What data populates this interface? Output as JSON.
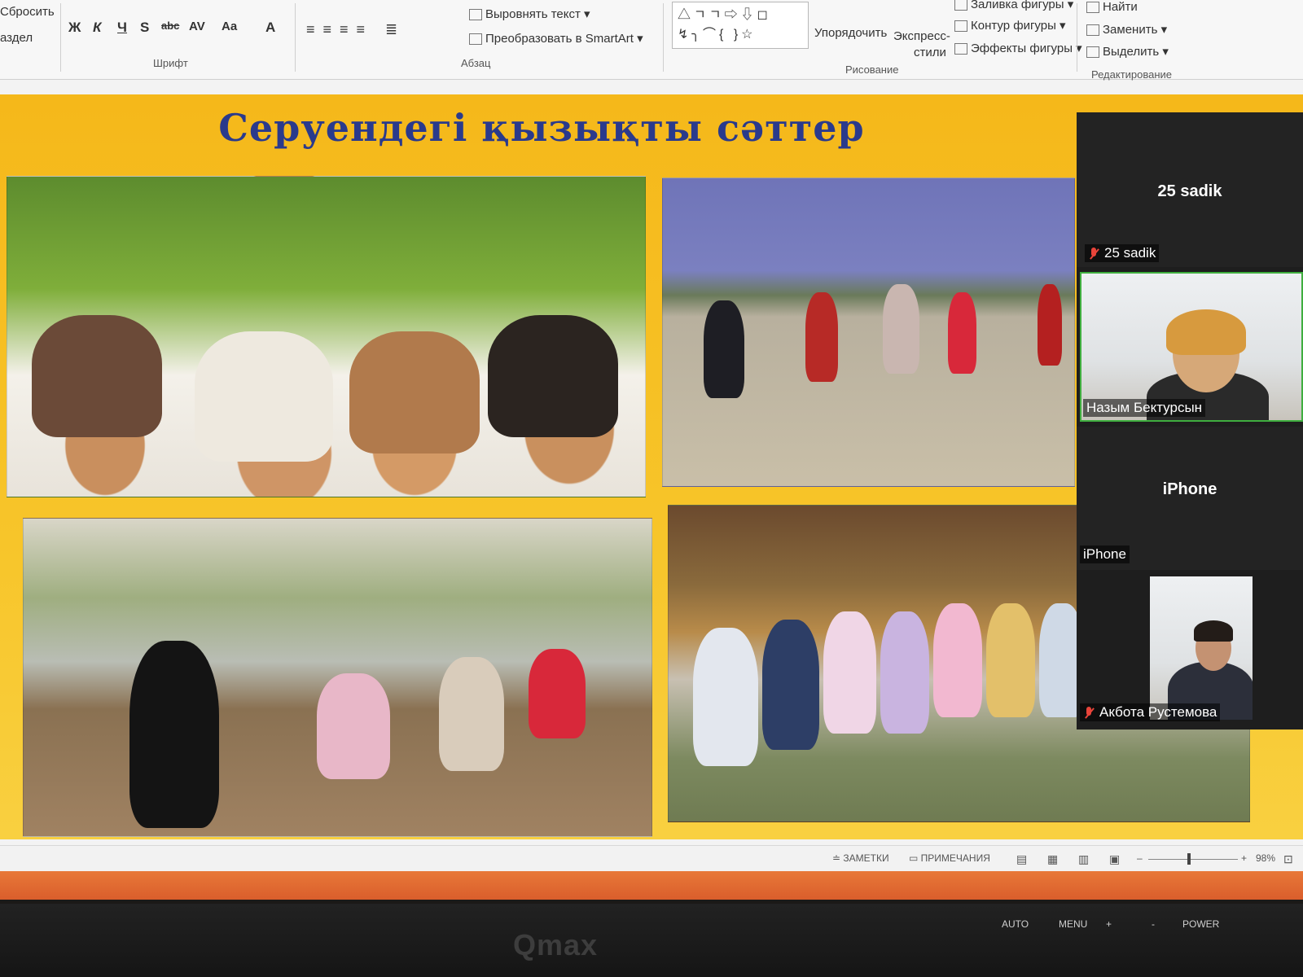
{
  "ribbon": {
    "reset_label": "Сбросить",
    "section_label": "аздел",
    "font_buttons": [
      "Ж",
      "К",
      "Ч",
      "S",
      "abc",
      "AV",
      "Aa",
      "A"
    ],
    "font_group": "Шрифт",
    "paragraph_group": "Абзац",
    "align_text": "Выровнять текст",
    "convert_smartart": "Преобразовать в SmartArt",
    "drawing_group": "Рисование",
    "arrange": "Упорядочить",
    "express_styles_1": "Экспресс-",
    "express_styles_2": "стили",
    "shape_fill": "Заливка фигуры",
    "shape_outline": "Контур фигуры",
    "shape_effects": "Эффекты фигуры",
    "find": "Найти",
    "replace": "Заменить",
    "select": "Выделить",
    "editing_group": "Редактирование"
  },
  "slide": {
    "title": "Серуендегі қызықты сәттер"
  },
  "participants": [
    {
      "name": "25 sadik",
      "label": "25 sadik",
      "muted": true,
      "video": false
    },
    {
      "name": "Назым Бектурсын",
      "muted": false,
      "video": true
    },
    {
      "name": "iPhone",
      "label": "iPhone",
      "muted": false,
      "video": false
    },
    {
      "name": "Акбота Рустемова",
      "muted": true,
      "video": true
    }
  ],
  "statusbar": {
    "notes": "ЗАМЕТКИ",
    "comments": "ПРИМЕЧАНИЯ",
    "zoom": "98%"
  },
  "monitor": {
    "brand": "Qmax",
    "buttons": [
      "AUTO",
      "MENU",
      "+",
      "-",
      "POWER"
    ]
  },
  "colors": {
    "title": "#2a3a8c",
    "slide_bg": "#f5b81a",
    "mute": "#e8443a",
    "active_speaker": "#3fae3f"
  }
}
